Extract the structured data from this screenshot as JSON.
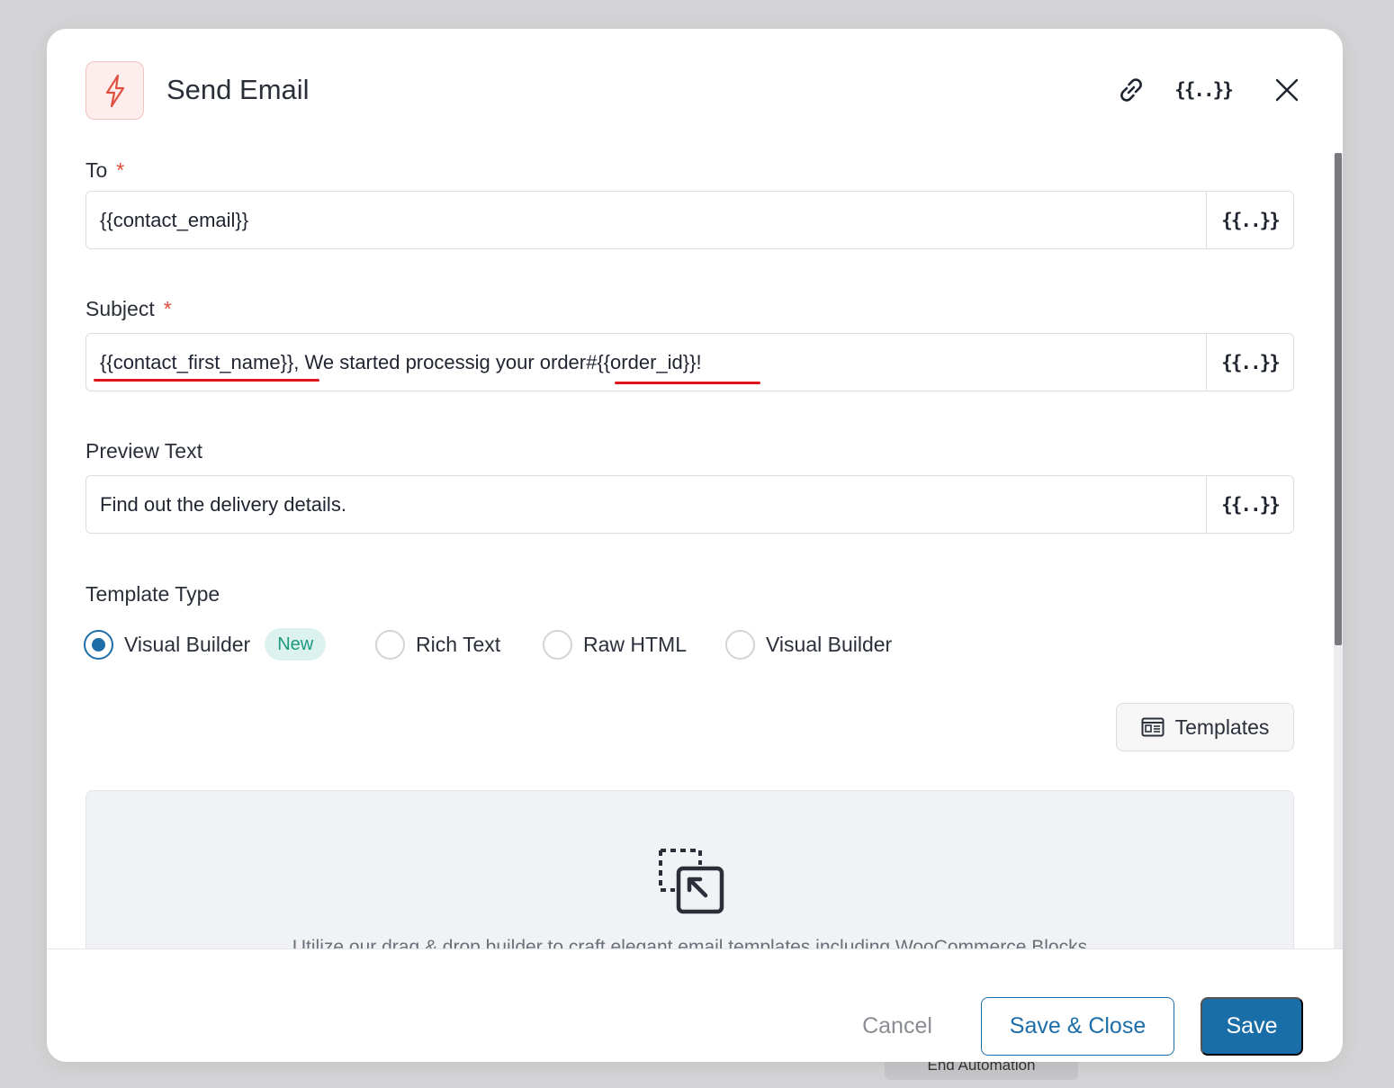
{
  "background": {
    "behind_label": "End Automation"
  },
  "modal": {
    "title": "Send Email",
    "icon_name": "bolt-icon",
    "header_actions": [
      {
        "name": "link-icon"
      },
      {
        "name": "merge-tags-icon",
        "glyph": "{{..}}"
      },
      {
        "name": "close-icon"
      }
    ]
  },
  "form": {
    "to": {
      "label": "To",
      "required_mark": "*",
      "value": "{{contact_email}}",
      "merge_glyph": "{{..}}"
    },
    "subject": {
      "label": "Subject",
      "required_mark": "*",
      "value_part1": "{{contact_first_name}}",
      "value_part2": ", We started processig your order ",
      "value_part3": "#{{order_id}}",
      "value_part4": "!",
      "merge_glyph": "{{..}}"
    },
    "preview_text": {
      "label": "Preview Text",
      "value": "Find out the delivery details.",
      "merge_glyph": "{{..}}"
    },
    "template_type": {
      "label": "Template Type",
      "options": [
        {
          "label": "Visual Builder",
          "checked": true,
          "badge": "New"
        },
        {
          "label": "Rich Text",
          "checked": false
        },
        {
          "label": "Raw HTML",
          "checked": false
        },
        {
          "label": "Visual Builder",
          "checked": false
        }
      ]
    },
    "templates_button": "Templates",
    "builder_hint": "Utilize our drag & drop builder to craft elegant email templates including WooCommerce Blocks"
  },
  "footer": {
    "cancel": "Cancel",
    "save_close": "Save & Close",
    "save": "Save"
  },
  "colors": {
    "accent": "#1a6ea8",
    "required": "#e04a3a",
    "annotation": "#e0141b",
    "badge_bg": "#dcf2ee",
    "badge_text": "#1c9a80"
  }
}
